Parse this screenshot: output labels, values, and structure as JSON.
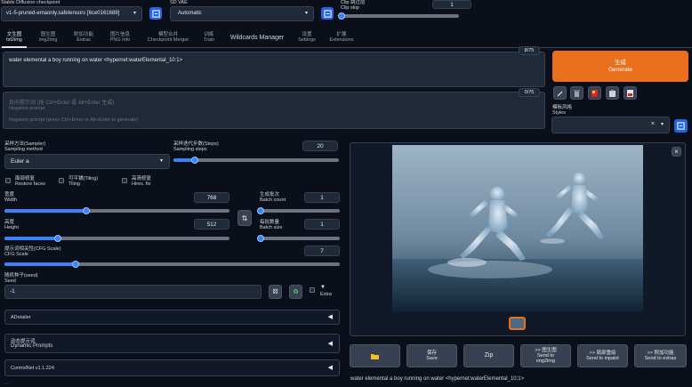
{
  "top": {
    "checkpoint_label": "Stable Diffusion checkpoint",
    "checkpoint_value": "v1-5-pruned-emaonly.safetensors [6ce0161689]",
    "vae_label": "SD VAE",
    "vae_value": "Automatic",
    "clip_label_cn": "Clip 跳过层",
    "clip_label": "Clip skip",
    "clip_value": "1"
  },
  "tabs": [
    {
      "cn": "文生图",
      "en": "txt2img"
    },
    {
      "cn": "图生图",
      "en": "img2img"
    },
    {
      "cn": "附加功能",
      "en": "Extras"
    },
    {
      "cn": "图片信息",
      "en": "PNG Info"
    },
    {
      "cn": "模型合并",
      "en": "Checkpoint Merger"
    },
    {
      "cn": "训练",
      "en": "Train"
    },
    {
      "cn": "",
      "en": "Wildcards Manager"
    },
    {
      "cn": "设置",
      "en": "Settings"
    },
    {
      "cn": "扩展",
      "en": "Extensions"
    }
  ],
  "prompt": {
    "text": "water elemental a boy running on water <hypernet:waterElemental_10:1>",
    "count": "8/75",
    "neg_placeholder_cn": "反向提示词 (按 Ctrl+Enter 或 Alt+Enter 生成)",
    "neg_placeholder_en1": "Negative prompt",
    "neg_placeholder_en2": "Negative prompt (press Ctrl+Enter or Alt+Enter to generate)",
    "neg_count": "0/75"
  },
  "generate": {
    "cn": "生成",
    "en": "Generate"
  },
  "styles": {
    "cn": "模板风格",
    "en": "Styles",
    "clear": "×"
  },
  "sampler": {
    "label_cn": "采样方法(Sampler)",
    "label_en": "Sampling method",
    "value": "Euler a"
  },
  "steps": {
    "label_cn": "采样迭代步数(Steps)",
    "label_en": "Sampling steps",
    "value": "20",
    "fraction": 0.13
  },
  "checks": {
    "restore_cn": "面部修复",
    "restore_en": "Restore faces",
    "tiling_cn": "可平铺(Tiling)",
    "tiling_en": "Tiling",
    "hires_cn": "高清修复",
    "hires_en": "Hires. fix"
  },
  "width": {
    "label_cn": "宽度",
    "label_en": "Width",
    "value": "768",
    "fraction": 0.35
  },
  "height": {
    "label_cn": "高度",
    "label_en": "Height",
    "value": "512",
    "fraction": 0.22
  },
  "batch_count": {
    "label_cn": "生成批次",
    "label_en": "Batch count",
    "value": "1",
    "fraction": 0.0
  },
  "batch_size": {
    "label_cn": "每批数量",
    "label_en": "Batch size",
    "value": "1",
    "fraction": 0.0
  },
  "cfg": {
    "label_cn": "提示词相关性(CFG Scale)",
    "label_en": "CFG Scale",
    "value": "7",
    "fraction": 0.2
  },
  "seed": {
    "label_cn": "随机种子(seed)",
    "label_en": "Seed",
    "value": "-1",
    "extra": "Extra"
  },
  "accordions": [
    {
      "cn": "",
      "en": "ADetailer"
    },
    {
      "cn": "动态提示词",
      "en": "Dynamic Prompts"
    },
    {
      "cn": "",
      "en": "ControlNet v1.1.224"
    }
  ],
  "gallery": {
    "close": "×",
    "buttons": [
      {
        "cn": "",
        "en": ""
      },
      {
        "cn": "保存",
        "en": "Save"
      },
      {
        "cn": "",
        "en": "Zip"
      },
      {
        "cn": ">> 图生图",
        "en": "Send to img2img"
      },
      {
        "cn": ">> 局部重绘",
        "en": "Send to inpaint"
      },
      {
        "cn": ">> 附加功能",
        "en": "Send to extras"
      }
    ],
    "caption": "water elemental a boy running on water <hypernet:waterElemental_10:1>"
  },
  "colors": {
    "accent": "#ea6f1c",
    "blue": "#3b82f6"
  }
}
